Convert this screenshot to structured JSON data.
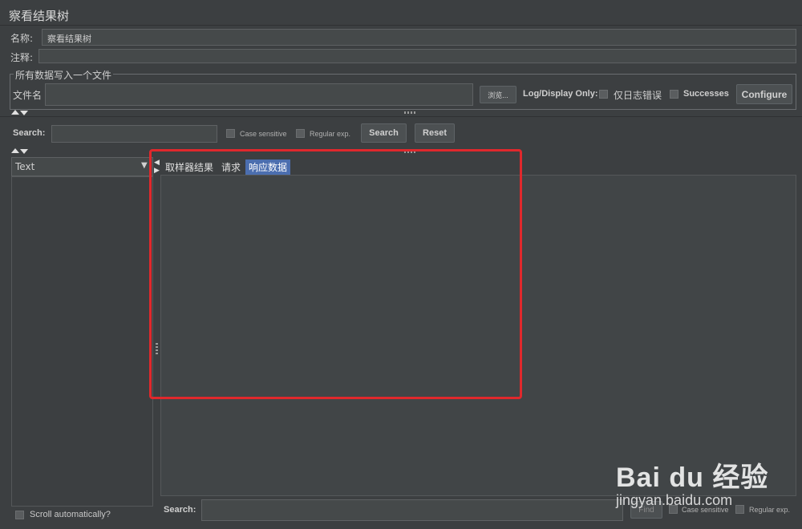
{
  "panel": {
    "title": "察看结果树"
  },
  "name_row": {
    "label": "名称:",
    "value": "察看结果树"
  },
  "comment_row": {
    "label": "注释:",
    "value": ""
  },
  "file_group": {
    "legend": "所有数据写入一个文件",
    "filename_label": "文件名",
    "filename_value": "",
    "browse_label": "浏览...",
    "log_display_label": "Log/Display Only:",
    "errors_label": "仅日志错误",
    "successes_label": "Successes",
    "configure_label": "Configure"
  },
  "search_bar": {
    "label": "Search:",
    "value": "",
    "case_label": "Case sensitive",
    "regex_label": "Regular exp.",
    "search_button": "Search",
    "reset_button": "Reset"
  },
  "renderer_select": {
    "selected": "Text"
  },
  "tabs": [
    {
      "label": "取样器结果",
      "active": false
    },
    {
      "label": "请求",
      "active": false
    },
    {
      "label": "响应数据",
      "active": true
    }
  ],
  "scroll_auto": {
    "label": "Scroll automatically?"
  },
  "bottom_search": {
    "label": "Search:",
    "value": "",
    "find_label": "Find",
    "case_label": "Case sensitive",
    "regex_label": "Regular exp."
  },
  "watermark": {
    "brand_text": "Bai du 经验",
    "url": "jingyan.baidu.com"
  },
  "colors": {
    "background": "#3c3f41",
    "active_tab": "#4b6eaf",
    "highlight_box": "#e0282c"
  }
}
